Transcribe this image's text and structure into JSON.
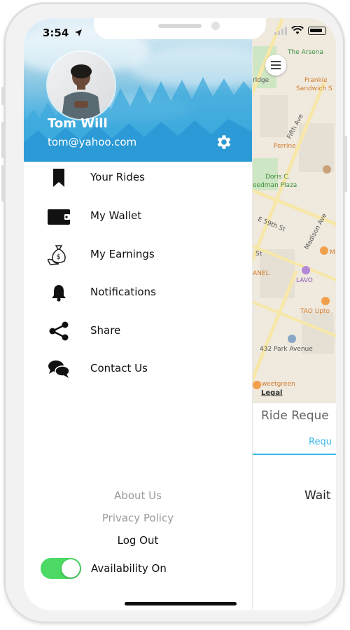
{
  "status_bar": {
    "time": "3:54"
  },
  "profile": {
    "name": "Tom Will",
    "email": "tom@yahoo.com"
  },
  "menu": [
    {
      "label": "Your Rides",
      "icon": "bookmark-icon"
    },
    {
      "label": "My Wallet",
      "icon": "wallet-icon"
    },
    {
      "label": "My Earnings",
      "icon": "money-bag-icon"
    },
    {
      "label": "Notifications",
      "icon": "bell-icon"
    },
    {
      "label": "Share",
      "icon": "share-icon"
    },
    {
      "label": "Contact Us",
      "icon": "chat-icon"
    }
  ],
  "footer": {
    "about": "About Us",
    "privacy": "Privacy Policy",
    "logout": "Log Out"
  },
  "availability": {
    "label": "Availability On",
    "on": true,
    "toggle_color": "#4cd964"
  },
  "map": {
    "labels": [
      "The Arsena",
      "Frankie",
      "Sandwich S",
      "Fifth Ave",
      "Perrine",
      "Doris C.",
      "eedman Plaza",
      "E 59th St",
      "Madison Ave",
      "M",
      "LAVO",
      "ANEL",
      "TAO Upto",
      "432 Park Avenue",
      "sweetgreen",
      "ridge",
      "St"
    ],
    "legal": "Legal"
  },
  "ride_panel": {
    "title": "Ride Reque",
    "tab": "Requ",
    "waiting": "Wait"
  },
  "colors": {
    "accent": "#35b6e8",
    "header_blue": "#2c9fd9"
  }
}
